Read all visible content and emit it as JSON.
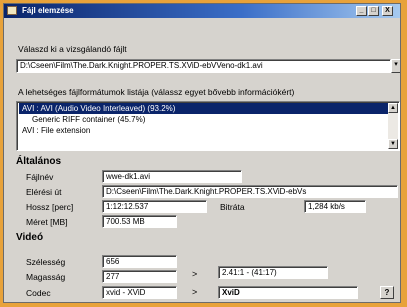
{
  "window": {
    "title": "Fájl elemzése",
    "buttons": {
      "minimize": "_",
      "restore": "□",
      "close": "X"
    }
  },
  "file_select": {
    "label": "Válaszd ki a vizsgálandó fájlt",
    "value": "D:\\Cseen\\Film\\The.Dark.Knight.PROPER.TS.XViD-ebVVeno-dk1.avi"
  },
  "format_list": {
    "label": "A lehetséges fájlformátumok listája (válassz egyet bővebb információkért)",
    "items": [
      {
        "label": "AVI : AVI (Audio Video Interleaved) (93.2%)",
        "selected": true
      },
      {
        "label": "Generic RIFF container (45.7%)",
        "selected": false
      },
      {
        "label": "AVI : File extension",
        "selected": false
      }
    ]
  },
  "general": {
    "heading": "Általános",
    "filename_label": "Fájlnév",
    "filename_value": "wwe-dk1.avi",
    "path_label": "Elérési út",
    "path_value": "D:\\Cseen\\Film\\The.Dark.Knight.PROPER.TS.XViD-ebVs",
    "length_label": "Hossz [perc]",
    "length_value": "1:12:12.537",
    "bitrate_label": "Bitráta",
    "bitrate_value": "1,284 kb/s",
    "size_label": "Méret [MB]",
    "size_value": "700.53 MB"
  },
  "video": {
    "heading": "Videó",
    "width_label": "Szélesség",
    "width_value": "656",
    "height_label": "Magasság",
    "height_value": "277",
    "ratio_arrow": ">",
    "ratio_value": "2.41:1 - (41:17)",
    "codec_label": "Codec",
    "codec_value": "xvid - XViD",
    "codec_arrow": ">",
    "codec_name": "XviD",
    "help_label": "?"
  },
  "colors": {
    "selection": "#0a246a",
    "window_bg": "#d6d3ce",
    "desktop": "#e8a23a"
  }
}
